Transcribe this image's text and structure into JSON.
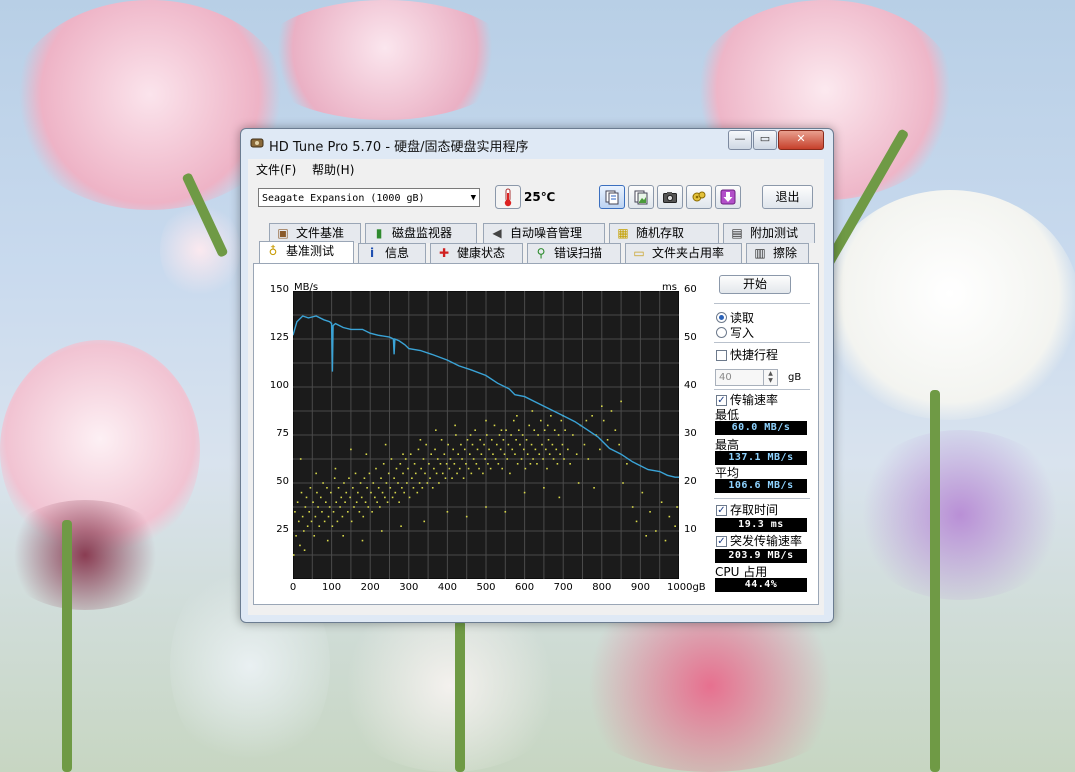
{
  "window": {
    "title": "HD Tune Pro 5.70 - 硬盘/固态硬盘实用程序",
    "min": "—",
    "max": "▭",
    "close": "✕"
  },
  "menu": [
    "文件(F)",
    "帮助(H)"
  ],
  "toolbar": {
    "drive": "Seagate Expansion (1000 gB)",
    "temperature": "25℃",
    "exit_label": "退出",
    "buttons": [
      "copy-text-icon",
      "copy-image-icon",
      "camera-icon",
      "options-icon",
      "download-icon"
    ]
  },
  "tabs_top": [
    {
      "label": "文件基准",
      "icon": "file-benchmark-icon"
    },
    {
      "label": "磁盘监视器",
      "icon": "disk-monitor-icon"
    },
    {
      "label": "自动噪音管理",
      "icon": "speaker-icon"
    },
    {
      "label": "随机存取",
      "icon": "random-access-icon"
    },
    {
      "label": "附加测试",
      "icon": "extra-tests-icon"
    }
  ],
  "tabs_bottom": [
    {
      "label": "基准测试",
      "icon": "benchmark-icon",
      "active": true
    },
    {
      "label": "信息",
      "icon": "info-icon"
    },
    {
      "label": "健康状态",
      "icon": "health-icon"
    },
    {
      "label": "错误扫描",
      "icon": "error-scan-icon"
    },
    {
      "label": "文件夹占用率",
      "icon": "folder-usage-icon"
    },
    {
      "label": "擦除",
      "icon": "erase-icon"
    }
  ],
  "side": {
    "start_label": "开始",
    "read_label": "读取",
    "write_label": "写入",
    "mode": "read",
    "short_stroke_label": "快捷行程",
    "short_stroke_checked": false,
    "short_stroke_value": "40",
    "short_stroke_unit": "gB",
    "transfer_rate_label": "传输速率",
    "transfer_rate_checked": true,
    "min_label": "最低",
    "min_value": "60.0 MB/s",
    "max_label": "最高",
    "max_value": "137.1 MB/s",
    "avg_label": "平均",
    "avg_value": "106.6 MB/s",
    "access_time_label": "存取时间",
    "access_time_checked": true,
    "access_time_value": "19.3 ms",
    "burst_label": "突发传输速率",
    "burst_checked": true,
    "burst_value": "203.9 MB/s",
    "cpu_label": "CPU 占用",
    "cpu_value": "44.4%"
  },
  "chart_data": {
    "type": "line",
    "ylabel_left": "MB/s",
    "ylabel_right": "ms",
    "x_unit_label": "1000gB",
    "x_ticks": [
      "0",
      "100",
      "200",
      "300",
      "400",
      "500",
      "600",
      "700",
      "800",
      "900"
    ],
    "y_left_ticks": [
      "150",
      "125",
      "100",
      "75",
      "50",
      "25"
    ],
    "y_right_ticks": [
      "60",
      "50",
      "40",
      "30",
      "20",
      "10"
    ],
    "xlim": [
      0,
      1000
    ],
    "ylim_left": [
      0,
      150
    ],
    "ylim_right": [
      0,
      60
    ],
    "grid": true,
    "background": "#1b1b1b",
    "series": [
      {
        "color": "#3aa3d6",
        "axis": "left",
        "x": [
          0,
          10,
          25,
          40,
          60,
          80,
          95,
          100,
          102,
          104,
          110,
          130,
          150,
          180,
          200,
          220,
          250,
          260,
          262,
          264,
          275,
          290,
          300,
          330,
          360,
          400,
          430,
          460,
          500,
          530,
          560,
          575,
          600,
          630,
          660,
          700,
          730,
          760,
          790,
          800,
          820,
          840,
          850,
          880,
          900,
          920,
          950,
          970,
          990,
          1000
        ],
        "y": [
          127,
          134,
          137,
          136,
          137,
          135,
          134,
          133,
          108,
          132,
          133,
          131,
          130,
          130,
          128,
          127,
          126,
          125,
          117,
          125,
          124,
          122,
          120,
          119,
          117,
          114,
          111,
          109,
          106,
          102,
          99,
          96,
          95,
          92,
          89,
          85,
          82,
          78,
          74,
          72,
          68,
          66,
          65,
          61,
          59,
          57,
          56,
          54,
          53,
          53
        ]
      }
    ],
    "scatter": {
      "color": "#d8d84a",
      "axis": "right",
      "points": [
        [
          2,
          5
        ],
        [
          5,
          14
        ],
        [
          8,
          9
        ],
        [
          12,
          16
        ],
        [
          15,
          12
        ],
        [
          18,
          7
        ],
        [
          22,
          18
        ],
        [
          25,
          13
        ],
        [
          28,
          10
        ],
        [
          32,
          15
        ],
        [
          35,
          17
        ],
        [
          38,
          11
        ],
        [
          42,
          14
        ],
        [
          45,
          19
        ],
        [
          48,
          12
        ],
        [
          52,
          16
        ],
        [
          55,
          9
        ],
        [
          58,
          13
        ],
        [
          62,
          18
        ],
        [
          65,
          15
        ],
        [
          68,
          11
        ],
        [
          72,
          17
        ],
        [
          75,
          14
        ],
        [
          78,
          20
        ],
        [
          82,
          12
        ],
        [
          85,
          16
        ],
        [
          88,
          19
        ],
        [
          92,
          13
        ],
        [
          95,
          15
        ],
        [
          98,
          18
        ],
        [
          102,
          11
        ],
        [
          105,
          14
        ],
        [
          108,
          21
        ],
        [
          112,
          16
        ],
        [
          115,
          12
        ],
        [
          118,
          19
        ],
        [
          122,
          15
        ],
        [
          125,
          17
        ],
        [
          128,
          13
        ],
        [
          132,
          20
        ],
        [
          135,
          16
        ],
        [
          138,
          18
        ],
        [
          142,
          14
        ],
        [
          145,
          21
        ],
        [
          148,
          17
        ],
        [
          152,
          12
        ],
        [
          155,
          19
        ],
        [
          158,
          15
        ],
        [
          162,
          22
        ],
        [
          165,
          16
        ],
        [
          168,
          18
        ],
        [
          172,
          14
        ],
        [
          175,
          20
        ],
        [
          178,
          17
        ],
        [
          182,
          13
        ],
        [
          185,
          21
        ],
        [
          188,
          16
        ],
        [
          192,
          19
        ],
        [
          195,
          15
        ],
        [
          198,
          22
        ],
        [
          202,
          18
        ],
        [
          205,
          14
        ],
        [
          208,
          20
        ],
        [
          212,
          17
        ],
        [
          215,
          23
        ],
        [
          218,
          16
        ],
        [
          222,
          19
        ],
        [
          225,
          15
        ],
        [
          228,
          21
        ],
        [
          232,
          18
        ],
        [
          235,
          24
        ],
        [
          238,
          17
        ],
        [
          242,
          20
        ],
        [
          245,
          16
        ],
        [
          248,
          22
        ],
        [
          252,
          19
        ],
        [
          255,
          25
        ],
        [
          258,
          17
        ],
        [
          262,
          21
        ],
        [
          265,
          18
        ],
        [
          268,
          23
        ],
        [
          272,
          20
        ],
        [
          275,
          16
        ],
        [
          278,
          24
        ],
        [
          282,
          19
        ],
        [
          285,
          22
        ],
        [
          288,
          18
        ],
        [
          292,
          25
        ],
        [
          295,
          20
        ],
        [
          298,
          23
        ],
        [
          302,
          17
        ],
        [
          305,
          26
        ],
        [
          308,
          21
        ],
        [
          312,
          19
        ],
        [
          315,
          24
        ],
        [
          318,
          22
        ],
        [
          322,
          18
        ],
        [
          325,
          27
        ],
        [
          328,
          20
        ],
        [
          332,
          23
        ],
        [
          335,
          19
        ],
        [
          338,
          25
        ],
        [
          342,
          22
        ],
        [
          345,
          28
        ],
        [
          348,
          20
        ],
        [
          352,
          24
        ],
        [
          355,
          21
        ],
        [
          358,
          26
        ],
        [
          362,
          19
        ],
        [
          365,
          23
        ],
        [
          368,
          27
        ],
        [
          372,
          22
        ],
        [
          375,
          25
        ],
        [
          378,
          20
        ],
        [
          382,
          24
        ],
        [
          385,
          29
        ],
        [
          388,
          22
        ],
        [
          392,
          26
        ],
        [
          395,
          21
        ],
        [
          398,
          24
        ],
        [
          402,
          28
        ],
        [
          405,
          23
        ],
        [
          408,
          25
        ],
        [
          412,
          21
        ],
        [
          415,
          27
        ],
        [
          418,
          24
        ],
        [
          422,
          30
        ],
        [
          425,
          22
        ],
        [
          428,
          26
        ],
        [
          432,
          23
        ],
        [
          435,
          28
        ],
        [
          438,
          25
        ],
        [
          442,
          21
        ],
        [
          445,
          27
        ],
        [
          448,
          24
        ],
        [
          452,
          29
        ],
        [
          455,
          23
        ],
        [
          458,
          26
        ],
        [
          462,
          22
        ],
        [
          465,
          28
        ],
        [
          468,
          25
        ],
        [
          472,
          31
        ],
        [
          475,
          24
        ],
        [
          478,
          27
        ],
        [
          482,
          23
        ],
        [
          485,
          29
        ],
        [
          488,
          26
        ],
        [
          492,
          22
        ],
        [
          495,
          28
        ],
        [
          498,
          25
        ],
        [
          502,
          30
        ],
        [
          505,
          24
        ],
        [
          508,
          27
        ],
        [
          512,
          23
        ],
        [
          515,
          29
        ],
        [
          518,
          26
        ],
        [
          522,
          32
        ],
        [
          525,
          25
        ],
        [
          528,
          28
        ],
        [
          532,
          24
        ],
        [
          535,
          30
        ],
        [
          538,
          27
        ],
        [
          542,
          23
        ],
        [
          545,
          29
        ],
        [
          548,
          26
        ],
        [
          552,
          31
        ],
        [
          555,
          25
        ],
        [
          558,
          28
        ],
        [
          562,
          22
        ],
        [
          565,
          30
        ],
        [
          568,
          27
        ],
        [
          572,
          33
        ],
        [
          575,
          26
        ],
        [
          578,
          29
        ],
        [
          582,
          24
        ],
        [
          585,
          31
        ],
        [
          588,
          28
        ],
        [
          592,
          25
        ],
        [
          595,
          30
        ],
        [
          598,
          27
        ],
        [
          602,
          23
        ],
        [
          605,
          29
        ],
        [
          608,
          26
        ],
        [
          612,
          32
        ],
        [
          615,
          24
        ],
        [
          618,
          28
        ],
        [
          622,
          25
        ],
        [
          625,
          31
        ],
        [
          628,
          27
        ],
        [
          632,
          24
        ],
        [
          635,
          30
        ],
        [
          638,
          26
        ],
        [
          642,
          33
        ],
        [
          645,
          28
        ],
        [
          648,
          25
        ],
        [
          652,
          31
        ],
        [
          655,
          27
        ],
        [
          658,
          23
        ],
        [
          662,
          29
        ],
        [
          665,
          26
        ],
        [
          668,
          34
        ],
        [
          672,
          28
        ],
        [
          675,
          25
        ],
        [
          678,
          31
        ],
        [
          682,
          27
        ],
        [
          685,
          24
        ],
        [
          688,
          30
        ],
        [
          692,
          26
        ],
        [
          695,
          33
        ],
        [
          698,
          28
        ],
        [
          702,
          25
        ],
        [
          705,
          31
        ],
        [
          712,
          27
        ],
        [
          718,
          24
        ],
        [
          725,
          30
        ],
        [
          735,
          26
        ],
        [
          745,
          32
        ],
        [
          755,
          28
        ],
        [
          765,
          25
        ],
        [
          775,
          34
        ],
        [
          785,
          30
        ],
        [
          795,
          27
        ],
        [
          805,
          33
        ],
        [
          815,
          29
        ],
        [
          825,
          35
        ],
        [
          835,
          31
        ],
        [
          845,
          28
        ],
        [
          855,
          20
        ],
        [
          865,
          24
        ],
        [
          880,
          15
        ],
        [
          890,
          12
        ],
        [
          905,
          18
        ],
        [
          915,
          9
        ],
        [
          925,
          14
        ],
        [
          940,
          10
        ],
        [
          955,
          16
        ],
        [
          965,
          8
        ],
        [
          975,
          13
        ],
        [
          990,
          11
        ],
        [
          995,
          15
        ],
        [
          20,
          25
        ],
        [
          60,
          22
        ],
        [
          110,
          23
        ],
        [
          150,
          27
        ],
        [
          190,
          26
        ],
        [
          240,
          28
        ],
        [
          285,
          26
        ],
        [
          330,
          29
        ],
        [
          370,
          31
        ],
        [
          420,
          32
        ],
        [
          460,
          30
        ],
        [
          500,
          33
        ],
        [
          540,
          31
        ],
        [
          580,
          34
        ],
        [
          620,
          35
        ],
        [
          660,
          32
        ],
        [
          700,
          34
        ],
        [
          760,
          33
        ],
        [
          800,
          36
        ],
        [
          850,
          37
        ],
        [
          30,
          6
        ],
        [
          90,
          8
        ],
        [
          130,
          9
        ],
        [
          180,
          8
        ],
        [
          230,
          10
        ],
        [
          280,
          11
        ],
        [
          340,
          12
        ],
        [
          400,
          14
        ],
        [
          450,
          13
        ],
        [
          500,
          15
        ],
        [
          550,
          14
        ],
        [
          600,
          18
        ],
        [
          650,
          19
        ],
        [
          690,
          17
        ],
        [
          740,
          20
        ],
        [
          780,
          19
        ]
      ]
    }
  }
}
